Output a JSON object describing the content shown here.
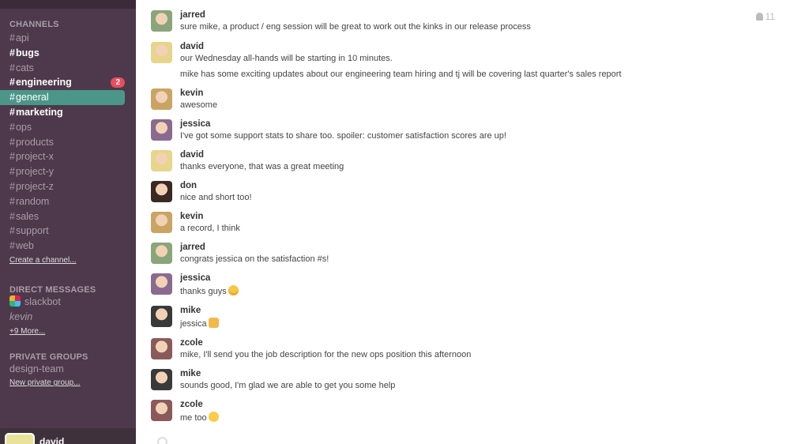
{
  "sidebar": {
    "channels_header": "CHANNELS",
    "channels": [
      {
        "name": "api",
        "style": "normal"
      },
      {
        "name": "bugs",
        "style": "bold"
      },
      {
        "name": "cats",
        "style": "normal"
      },
      {
        "name": "engineering",
        "style": "bold",
        "badge": "2"
      },
      {
        "name": "general",
        "style": "active"
      },
      {
        "name": "marketing",
        "style": "bold"
      },
      {
        "name": "ops",
        "style": "normal"
      },
      {
        "name": "products",
        "style": "normal"
      },
      {
        "name": "project-x",
        "style": "normal"
      },
      {
        "name": "project-y",
        "style": "normal"
      },
      {
        "name": "project-z",
        "style": "normal"
      },
      {
        "name": "random",
        "style": "normal"
      },
      {
        "name": "sales",
        "style": "normal"
      },
      {
        "name": "support",
        "style": "normal"
      },
      {
        "name": "web",
        "style": "normal"
      }
    ],
    "hash": "#",
    "create_channel": "Create a channel...",
    "dm_header": "DIRECT MESSAGES",
    "dms": [
      {
        "name": "slackbot",
        "icon": "slackbot-icon"
      },
      {
        "name": "kevin",
        "italic": true
      }
    ],
    "more_dms": "+9 More...",
    "groups_header": "PRIVATE GROUPS",
    "groups": [
      "design-team"
    ],
    "new_group": "New private group...",
    "current_user": "david",
    "colors": {
      "bg": "#4d394b",
      "active": "#4c9689",
      "badge": "#eb4d5c"
    }
  },
  "main": {
    "member_count": "11",
    "messages": [
      {
        "user": "jarred",
        "lines": [
          "sure mike, a product / eng session will be great to work out the kinks in our release process"
        ],
        "avatar": "#8aa57a"
      },
      {
        "user": "david",
        "lines": [
          "our Wednesday all-hands will be starting in 10 minutes.",
          "mike has some exciting updates about our engineering team hiring and tj will be covering last quarter's sales report"
        ],
        "avatar": "#e6d58a"
      },
      {
        "user": "kevin",
        "lines": [
          "awesome"
        ],
        "avatar": "#c9a463"
      },
      {
        "user": "jessica",
        "lines": [
          "I've got some support stats to share too. spoiler: customer satisfaction scores are up!"
        ],
        "avatar": "#8a6a8e"
      },
      {
        "user": "david",
        "lines": [
          "thanks everyone, that was a great meeting"
        ],
        "avatar": "#e6d58a"
      },
      {
        "user": "don",
        "lines": [
          "nice and short too!"
        ],
        "avatar": "#3b2a22"
      },
      {
        "user": "kevin",
        "lines": [
          "a record, I think"
        ],
        "avatar": "#c9a463"
      },
      {
        "user": "jarred",
        "lines": [
          "congrats jessica on the satisfaction #s!"
        ],
        "avatar": "#8aa57a"
      },
      {
        "user": "jessica",
        "lines": [
          "thanks guys"
        ],
        "emoji": "smile",
        "avatar": "#8a6a8e"
      },
      {
        "user": "mike",
        "lines": [
          "jessica"
        ],
        "emoji": "thumb",
        "avatar": "#3a3a3a"
      },
      {
        "user": "zcole",
        "lines": [
          "mike, I'll send you the job description for the new ops position this afternoon"
        ],
        "avatar": "#8a5a5a"
      },
      {
        "user": "mike",
        "lines": [
          "sounds good, I'm glad we are able to get you some help"
        ],
        "avatar": "#3a3a3a"
      },
      {
        "user": "zcole",
        "lines": [
          "me too"
        ],
        "emoji": "pleased",
        "avatar": "#8a5a5a"
      }
    ]
  }
}
